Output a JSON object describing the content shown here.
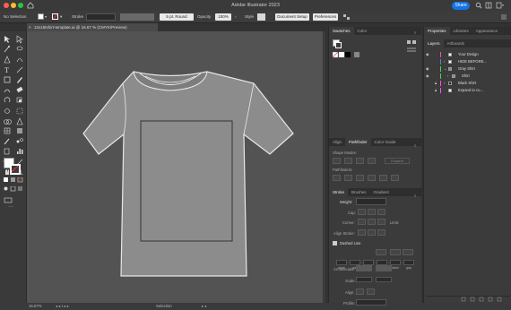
{
  "app": {
    "window_title": "Adobe Illustrator 2023",
    "share_label": "Share"
  },
  "control_bar": {
    "selection_label": "No Selection",
    "stroke_label": "Stroke",
    "stroke_profile": "5 pt. Round",
    "opacity_label": "Opacity",
    "opacity_value": "100%",
    "style_label": "Style",
    "doc_setup_label": "Document Setup",
    "preferences_label": "Preferences"
  },
  "document": {
    "tab_title": "12x16tshirt-template.ai @ 16.67 % (CMYK/Preview)",
    "close_glyph": "×"
  },
  "status_bar": {
    "zoom": "16.67%",
    "tool_name": "Selection"
  },
  "panels": {
    "swatches_tabs": [
      "Swatches",
      "Color"
    ],
    "pathfinder_tabs": [
      "Align",
      "Pathfinder",
      "Color Guide"
    ],
    "shape_modes_label": "Shape Modes:",
    "expand_label": "Expand",
    "pathfinders_label": "Pathfinders:",
    "stroke_tabs": [
      "Stroke",
      "Brushes",
      "Gradient"
    ],
    "weight_label": "Weight:",
    "cap_label": "Cap:",
    "corner_label": "Corner:",
    "limit_label": "Limit:",
    "align_stroke_label": "Align Stroke:",
    "dashed_line_label": "Dashed Line",
    "dash_fields": [
      "dash",
      "gap",
      "dash",
      "gap",
      "dash",
      "gap"
    ],
    "arrowheads_label": "Arrowheads:",
    "scale_label": "Scale:",
    "align_label": "Align:",
    "profile_label": "Profile:"
  },
  "right_panel": {
    "tabs": [
      "Properties",
      "Libraries",
      "Appearance"
    ],
    "layer_tabs": [
      "Layers",
      "Artboards"
    ],
    "layers": [
      {
        "name": "Your Design",
        "color": "#ff4fa0"
      },
      {
        "name": "HIDE BEFORE...",
        "color": "#4f7fff"
      },
      {
        "name": "Gray Shirt",
        "color": "#4fcf4f"
      },
      {
        "name": "Shirt",
        "color": "#4fcf4f"
      },
      {
        "name": "Black Shirt",
        "color": "#ff4fff"
      },
      {
        "name": "Expand to cu...",
        "color": "#ff4fff"
      }
    ]
  },
  "artwork": {
    "shirt_color": "#8c8c8c",
    "outline_color": "#e8e8e8",
    "print_area_color": "#2a2a2a"
  }
}
